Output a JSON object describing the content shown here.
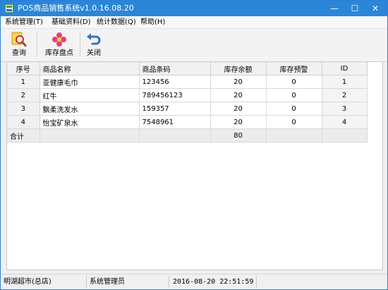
{
  "window": {
    "title": "POS商品销售系统v1.0.16.08.20",
    "minimize": "—",
    "maximize": "☐",
    "close": "✕"
  },
  "menu": [
    {
      "label": "系统管理(T)"
    },
    {
      "label": "基础资料(D)"
    },
    {
      "label": "统计数据(Q)"
    },
    {
      "label": "帮助(H)"
    }
  ],
  "toolbar": {
    "query_label": "查询",
    "stocktake_label": "库存盘点",
    "close_label": "关闭"
  },
  "grid": {
    "headers": {
      "seq": "序号",
      "name": "商品名称",
      "barcode": "商品条码",
      "stock": "库存余额",
      "warn": "库存预警",
      "id": "ID"
    },
    "rows": [
      {
        "seq": "1",
        "name": "亚健康毛巾",
        "barcode": "123456",
        "stock": "20",
        "warn": "0",
        "id": "1"
      },
      {
        "seq": "2",
        "name": "红牛",
        "barcode": "789456123",
        "stock": "20",
        "warn": "0",
        "id": "2"
      },
      {
        "seq": "3",
        "name": "飘柔洗发水",
        "barcode": "159357",
        "stock": "20",
        "warn": "0",
        "id": "3"
      },
      {
        "seq": "4",
        "name": "怡宝矿泉水",
        "barcode": "7548961",
        "stock": "20",
        "warn": "0",
        "id": "4"
      }
    ],
    "total": {
      "label": "合计",
      "stock": "80"
    }
  },
  "status": {
    "store": "明湖超市(总店)",
    "user": "系统管理员",
    "datetime": "2016-08-20 22:51:59"
  },
  "colors": {
    "titlebar": "#2b86d8",
    "accent": "#2b7fd6"
  },
  "icons": {
    "query": "magnifier-icon",
    "stocktake": "stock-flower-icon",
    "close": "undo-arrow-icon"
  }
}
